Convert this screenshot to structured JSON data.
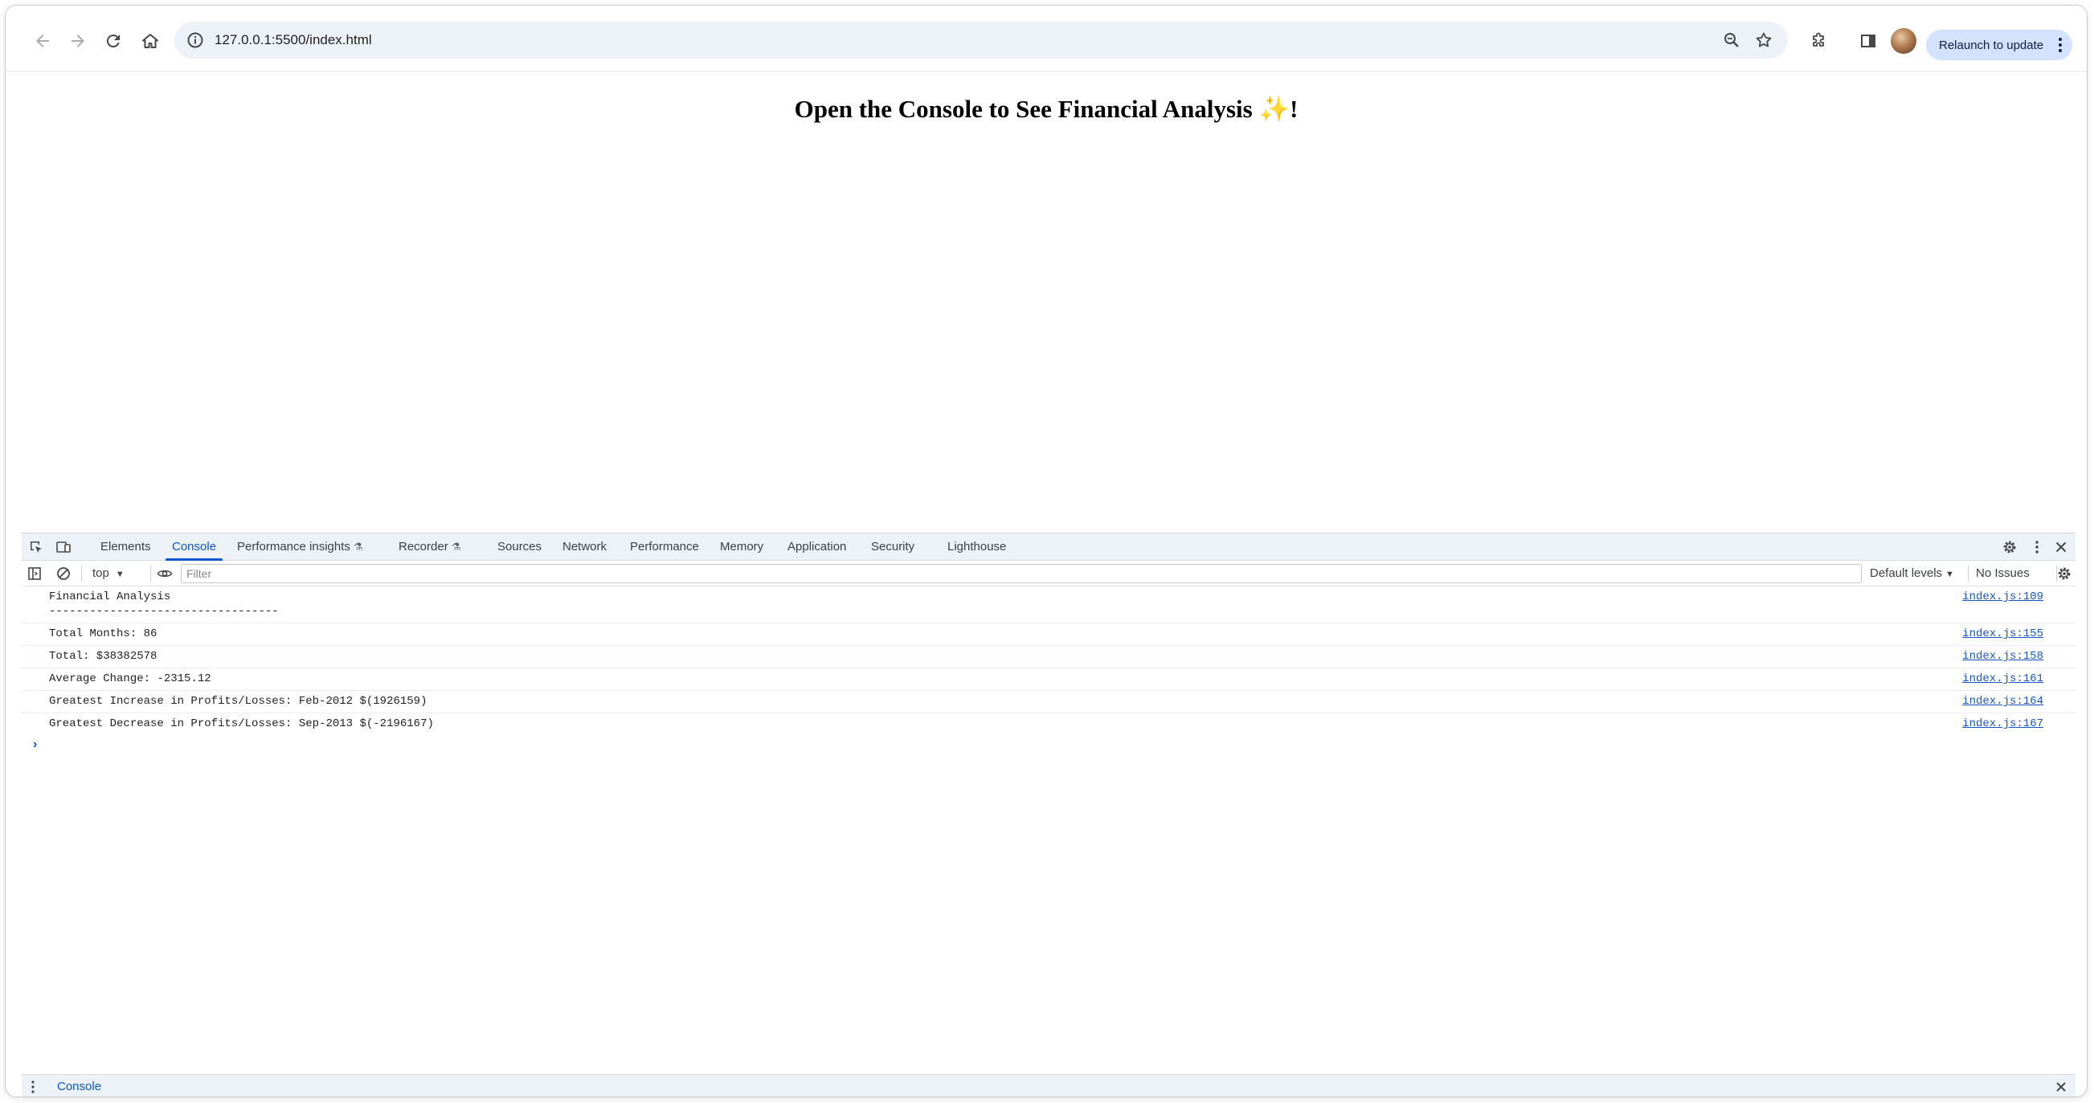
{
  "browser": {
    "url": "127.0.0.1:5500/index.html",
    "relaunch_label": "Relaunch to update"
  },
  "page": {
    "title_text": "Open the Console to See Financial Analysis ",
    "title_emoji": "✨",
    "title_end": "!"
  },
  "devtools": {
    "tabs": [
      {
        "label": "Elements"
      },
      {
        "label": "Console"
      },
      {
        "label": "Performance insights"
      },
      {
        "label": "Recorder"
      },
      {
        "label": "Sources"
      },
      {
        "label": "Network"
      },
      {
        "label": "Performance"
      },
      {
        "label": "Memory"
      },
      {
        "label": "Application"
      },
      {
        "label": "Security"
      },
      {
        "label": "Lighthouse"
      }
    ],
    "active_tab": "Console",
    "context": "top",
    "filter_placeholder": "Filter",
    "levels_label": "Default levels",
    "issues_label": "No Issues",
    "drawer_tab": "Console"
  },
  "console": {
    "lines": [
      {
        "text": "Financial Analysis\n----------------------------------",
        "source": "index.js:109"
      },
      {
        "text": "Total Months: 86",
        "source": "index.js:155"
      },
      {
        "text": "Total: $38382578",
        "source": "index.js:158"
      },
      {
        "text": "Average Change: -2315.12",
        "source": "index.js:161"
      },
      {
        "text": "Greatest Increase in Profits/Losses: Feb-2012 $(1926159)",
        "source": "index.js:164"
      },
      {
        "text": "Greatest Decrease in Profits/Losses: Sep-2013 $(-2196167)",
        "source": "index.js:167"
      }
    ]
  },
  "colors": {
    "accent": "#0b57d0",
    "link": "#1a55c4",
    "toolbar_bg": "#edf1f8",
    "relaunch_bg": "#d3e3fd"
  },
  "icons": {
    "back": "arrow-back-icon",
    "forward": "arrow-forward-icon",
    "reload": "reload-icon",
    "home": "home-icon",
    "info": "info-icon",
    "zoom": "zoom-icon",
    "bookmark": "star-icon",
    "extensions": "puzzle-icon",
    "sidepanel": "side-panel-icon",
    "menu": "kebab-menu-icon"
  }
}
